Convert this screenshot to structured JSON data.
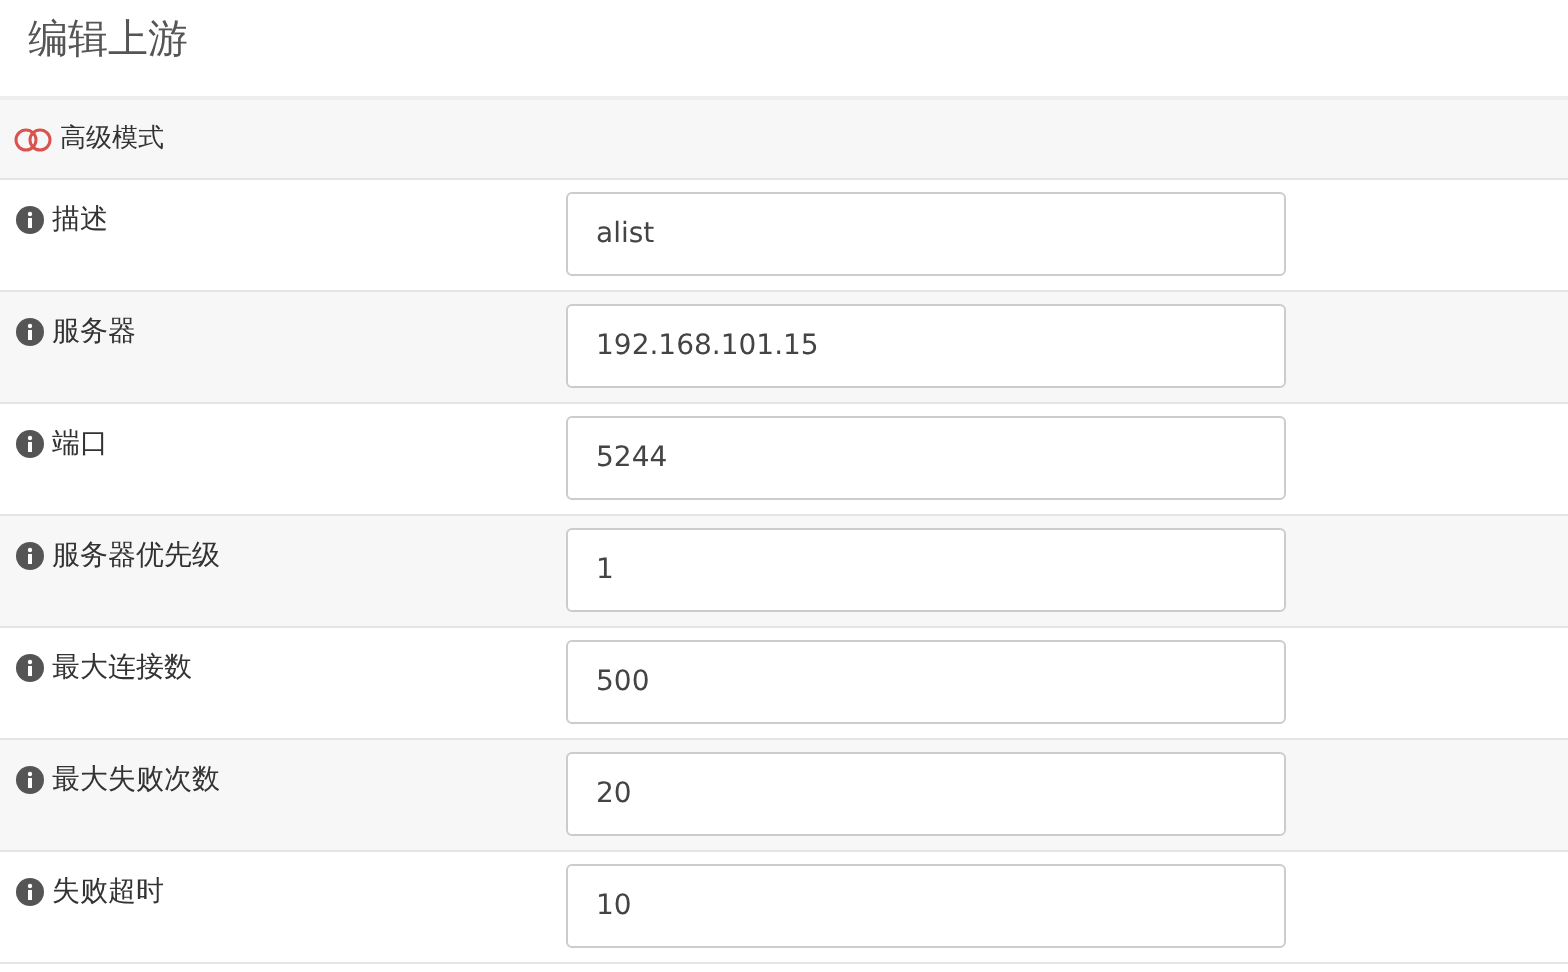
{
  "title": "编辑上游",
  "advanced_mode": {
    "label": "高级模式",
    "on": false
  },
  "fields": [
    {
      "label": "描述",
      "value": "alist"
    },
    {
      "label": "服务器",
      "value": "192.168.101.15"
    },
    {
      "label": "端口",
      "value": "5244"
    },
    {
      "label": "服务器优先级",
      "value": "1"
    },
    {
      "label": "最大连接数",
      "value": "500"
    },
    {
      "label": "最大失败次数",
      "value": "20"
    },
    {
      "label": "失败超时",
      "value": "10"
    }
  ]
}
